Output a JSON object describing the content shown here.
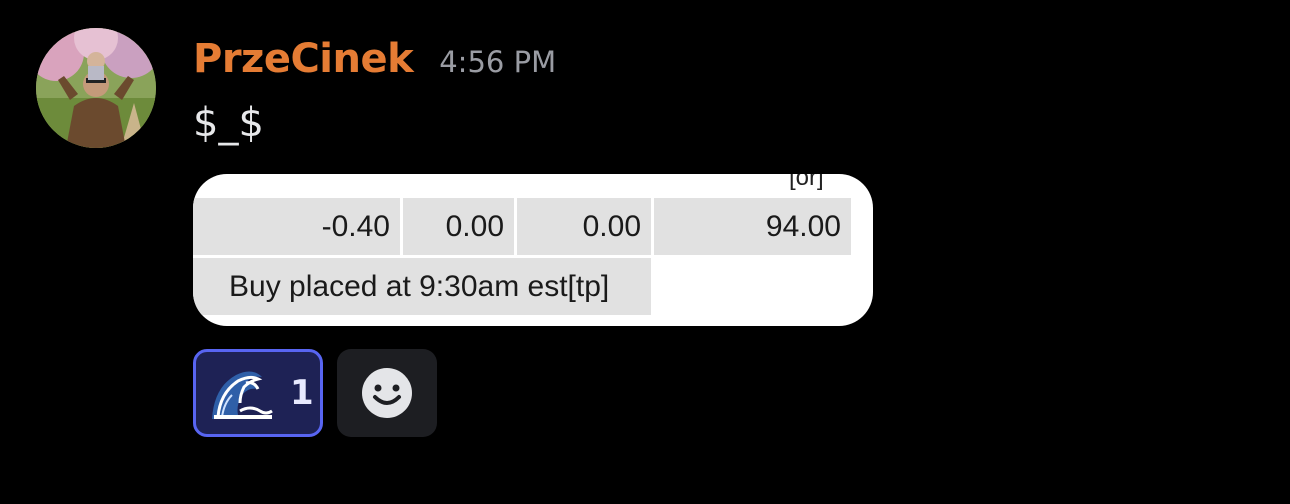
{
  "message": {
    "author": "PrzeCinek",
    "timestamp": "4:56 PM",
    "content": "$_$",
    "author_color": "#e57c34"
  },
  "attachment": {
    "cut_text": "[or]",
    "row1": [
      "-0.40",
      "0.00",
      "0.00",
      "94.00"
    ],
    "row2": "Buy placed at 9:30am est[tp]"
  },
  "reactions": [
    {
      "emoji": "wave-emoji",
      "count": "1",
      "active": true
    }
  ],
  "add_reaction_icon": "smiley-add-reaction-icon",
  "colors": {
    "background": "#000000",
    "reaction_border": "#5865f2",
    "reaction_bg": "#1e2255"
  }
}
